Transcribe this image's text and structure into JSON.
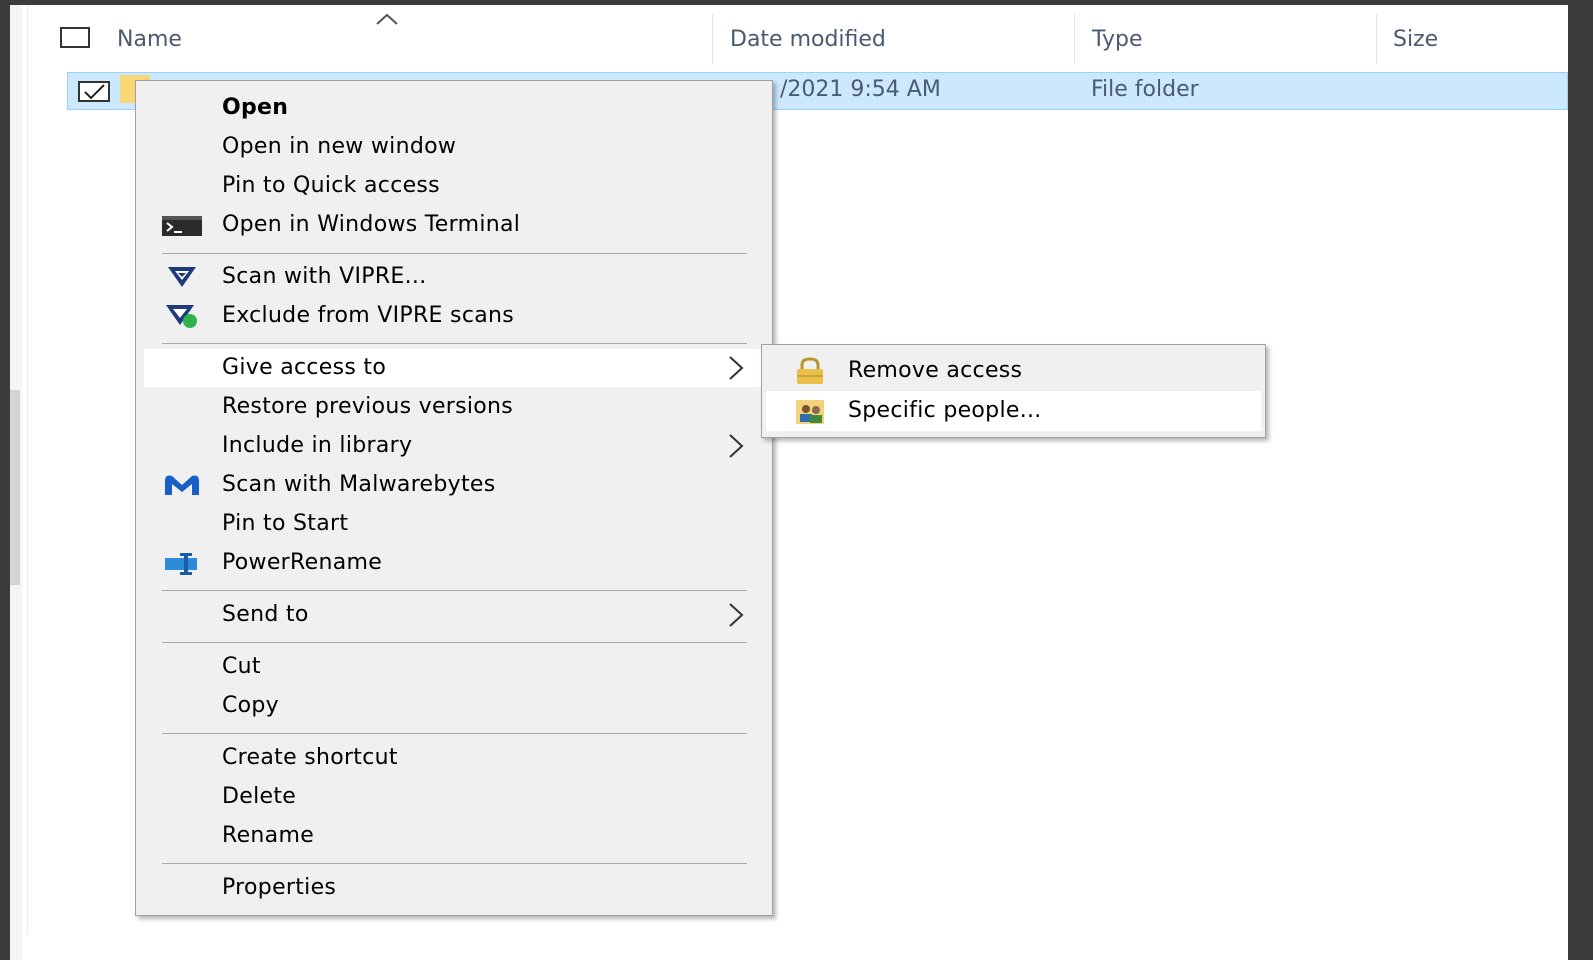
{
  "columns": {
    "name": "Name",
    "date_modified": "Date modified",
    "type": "Type",
    "size": "Size"
  },
  "row": {
    "date_modified": "/2021 9:54 AM",
    "type": "File folder",
    "checked": true
  },
  "context_menu": {
    "items": [
      {
        "label": "Open",
        "bold": true,
        "icon": "",
        "submenu": false
      },
      {
        "label": "Open in new window",
        "icon": "",
        "submenu": false
      },
      {
        "label": "Pin to Quick access",
        "icon": "",
        "submenu": false
      },
      {
        "label": "Open in Windows Terminal",
        "icon": "terminal-icon",
        "submenu": false
      },
      {
        "label": "Scan with VIPRE...",
        "icon": "vipre-icon",
        "submenu": false
      },
      {
        "label": "Exclude from VIPRE scans",
        "icon": "vipre-exclude-icon",
        "submenu": false
      },
      {
        "label": "Give access to",
        "icon": "",
        "submenu": true,
        "highlighted": true
      },
      {
        "label": "Restore previous versions",
        "icon": "",
        "submenu": false
      },
      {
        "label": "Include in library",
        "icon": "",
        "submenu": true
      },
      {
        "label": "Scan with Malwarebytes",
        "icon": "malwarebytes-icon",
        "submenu": false
      },
      {
        "label": "Pin to Start",
        "icon": "",
        "submenu": false
      },
      {
        "label": "PowerRename",
        "icon": "powerrename-icon",
        "submenu": false
      },
      {
        "label": "Send to",
        "icon": "",
        "submenu": true
      },
      {
        "label": "Cut",
        "icon": "",
        "submenu": false
      },
      {
        "label": "Copy",
        "icon": "",
        "submenu": false
      },
      {
        "label": "Create shortcut",
        "icon": "",
        "submenu": false
      },
      {
        "label": "Delete",
        "icon": "",
        "submenu": false
      },
      {
        "label": "Rename",
        "icon": "",
        "submenu": false
      },
      {
        "label": "Properties",
        "icon": "",
        "submenu": false
      }
    ]
  },
  "submenu": {
    "items": [
      {
        "label": "Remove access",
        "icon": "lock-icon"
      },
      {
        "label": "Specific people...",
        "icon": "people-icon",
        "highlighted": true
      }
    ]
  },
  "colors": {
    "selection_bg": "#cce8ff",
    "selection_border": "#99d1ff",
    "menu_bg": "#f0f0f0",
    "header_text": "#4a5a70"
  }
}
